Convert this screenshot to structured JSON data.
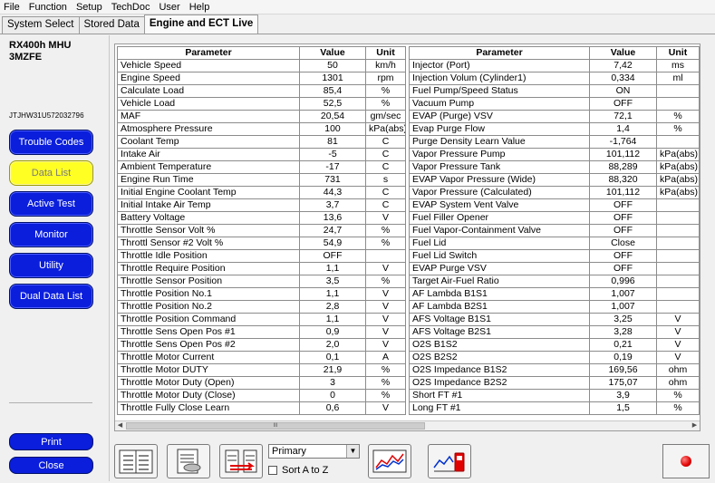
{
  "menu": [
    "File",
    "Function",
    "Setup",
    "TechDoc",
    "User",
    "Help"
  ],
  "tabs": [
    "System Select",
    "Stored Data",
    "Engine and ECT Live"
  ],
  "vehicle": {
    "model_line1": "RX400h MHU",
    "model_line2": "3MZFE",
    "vin": "JTJHW31U572032796"
  },
  "nav": {
    "trouble_codes": "Trouble Codes",
    "data_list": "Data List",
    "active_test": "Active Test",
    "monitor": "Monitor",
    "utility": "Utility",
    "dual_data_list": "Dual Data List",
    "print": "Print",
    "close": "Close"
  },
  "headers": {
    "parameter": "Parameter",
    "value": "Value",
    "unit": "Unit"
  },
  "left_rows": [
    [
      "Vehicle Speed",
      "50",
      "km/h"
    ],
    [
      "Engine Speed",
      "1301",
      "rpm"
    ],
    [
      "Calculate Load",
      "85,4",
      "%"
    ],
    [
      "Vehicle Load",
      "52,5",
      "%"
    ],
    [
      "MAF",
      "20,54",
      "gm/sec"
    ],
    [
      "Atmosphere Pressure",
      "100",
      "kPa(abs)"
    ],
    [
      "Coolant Temp",
      "81",
      "C"
    ],
    [
      "Intake Air",
      "-5",
      "C"
    ],
    [
      "Ambient Temperature",
      "-17",
      "C"
    ],
    [
      "Engine Run Time",
      "731",
      "s"
    ],
    [
      "Initial Engine Coolant Temp",
      "44,3",
      "C"
    ],
    [
      "Initial Intake Air Temp",
      "3,7",
      "C"
    ],
    [
      "Battery Voltage",
      "13,6",
      "V"
    ],
    [
      "Throttle Sensor Volt %",
      "24,7",
      "%"
    ],
    [
      "Throttl Sensor #2 Volt %",
      "54,9",
      "%"
    ],
    [
      "Throttle Idle Position",
      "OFF",
      ""
    ],
    [
      "Throttle Require Position",
      "1,1",
      "V"
    ],
    [
      "Throttle Sensor Position",
      "3,5",
      "%"
    ],
    [
      "Throttle Position No.1",
      "1,1",
      "V"
    ],
    [
      "Throttle Position No.2",
      "2,8",
      "V"
    ],
    [
      "Throttle Position Command",
      "1,1",
      "V"
    ],
    [
      "Throttle Sens Open Pos #1",
      "0,9",
      "V"
    ],
    [
      "Throttle Sens Open Pos #2",
      "2,0",
      "V"
    ],
    [
      "Throttle Motor Current",
      "0,1",
      "A"
    ],
    [
      "Throttle Motor DUTY",
      "21,9",
      "%"
    ],
    [
      "Throttle Motor Duty (Open)",
      "3",
      "%"
    ],
    [
      "Throttle Motor Duty (Close)",
      "0",
      "%"
    ],
    [
      "Throttle Fully Close Learn",
      "0,6",
      "V"
    ]
  ],
  "right_rows": [
    [
      "Injector (Port)",
      "7,42",
      "ms"
    ],
    [
      "Injection Volum (Cylinder1)",
      "0,334",
      "ml"
    ],
    [
      "Fuel Pump/Speed Status",
      "ON",
      ""
    ],
    [
      "Vacuum Pump",
      "OFF",
      ""
    ],
    [
      "EVAP (Purge) VSV",
      "72,1",
      "%"
    ],
    [
      "Evap Purge Flow",
      "1,4",
      "%"
    ],
    [
      "Purge Density Learn Value",
      "-1,764",
      ""
    ],
    [
      "Vapor Pressure Pump",
      "101,112",
      "kPa(abs)"
    ],
    [
      "Vapor Pressure Tank",
      "88,289",
      "kPa(abs)"
    ],
    [
      "EVAP Vapor Pressure (Wide)",
      "88,320",
      "kPa(abs)"
    ],
    [
      "Vapor Pressure (Calculated)",
      "101,112",
      "kPa(abs)"
    ],
    [
      "EVAP System Vent Valve",
      "OFF",
      ""
    ],
    [
      "Fuel Filler Opener",
      "OFF",
      ""
    ],
    [
      "Fuel Vapor-Containment Valve",
      "OFF",
      ""
    ],
    [
      "Fuel Lid",
      "Close",
      ""
    ],
    [
      "Fuel Lid Switch",
      "OFF",
      ""
    ],
    [
      "EVAP Purge VSV",
      "OFF",
      ""
    ],
    [
      "Target Air-Fuel Ratio",
      "0,996",
      ""
    ],
    [
      "AF Lambda B1S1",
      "1,007",
      ""
    ],
    [
      "AF Lambda B2S1",
      "1,007",
      ""
    ],
    [
      "AFS Voltage B1S1",
      "3,25",
      "V"
    ],
    [
      "AFS Voltage B2S1",
      "3,28",
      "V"
    ],
    [
      "O2S B1S2",
      "0,21",
      "V"
    ],
    [
      "O2S B2S2",
      "0,19",
      "V"
    ],
    [
      "O2S Impedance B1S2",
      "169,56",
      "ohm"
    ],
    [
      "O2S Impedance B2S2",
      "175,07",
      "ohm"
    ],
    [
      "Short FT #1",
      "3,9",
      "%"
    ],
    [
      "Long FT #1",
      "1,5",
      "%"
    ]
  ],
  "scroll_thumb_glyph": "III",
  "toolbar": {
    "select_value": "Primary",
    "sort_label": "Sort A to Z"
  }
}
